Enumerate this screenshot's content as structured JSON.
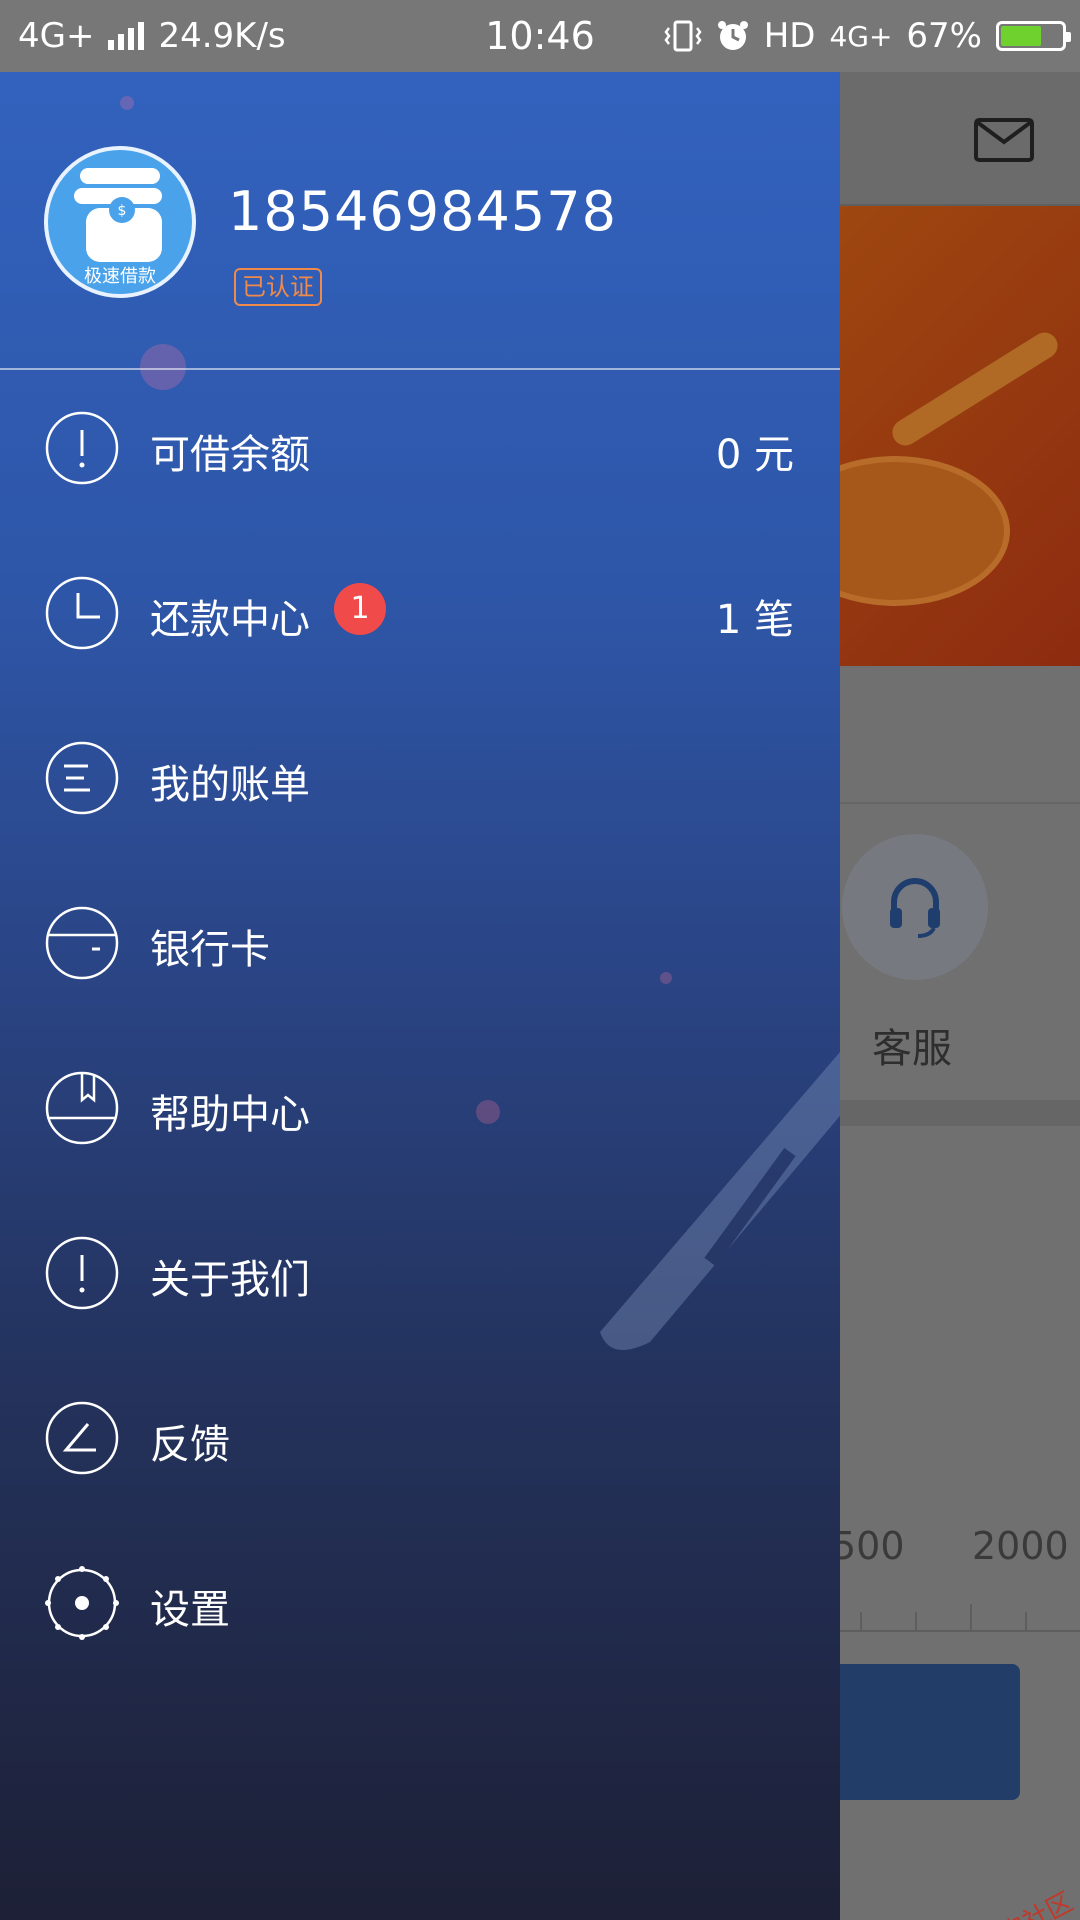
{
  "status_bar": {
    "network_left": "4G+",
    "speed": "24.9K/s",
    "time": "10:46",
    "hd": "HD",
    "network_right": "4G+",
    "battery_percent": "67%"
  },
  "background_page": {
    "service_label": "客服",
    "scale_left": "500",
    "scale_right": "2000"
  },
  "drawer": {
    "avatar_caption": "极速借款",
    "phone_number": "18546984578",
    "verified_badge": "已认证",
    "menu": [
      {
        "label": "可借余额",
        "value": "0 元",
        "icon": "exclamation-icon"
      },
      {
        "label": "还款中心",
        "value": "1 笔",
        "badge": "1",
        "icon": "clock-icon"
      },
      {
        "label": "我的账单",
        "icon": "list-icon"
      },
      {
        "label": "银行卡",
        "icon": "bank-card-icon"
      },
      {
        "label": "帮助中心",
        "icon": "help-book-icon"
      },
      {
        "label": "关于我们",
        "icon": "info-icon"
      },
      {
        "label": "反馈",
        "icon": "feedback-icon"
      },
      {
        "label": "设置",
        "icon": "settings-icon"
      }
    ]
  },
  "watermark": "卡农社区",
  "colors": {
    "drawer_top": "#3262be",
    "drawer_bottom": "#1d2036",
    "badge_red": "#f04a4a",
    "verified_orange": "#f08a4b",
    "battery_green": "#6fd12e"
  }
}
